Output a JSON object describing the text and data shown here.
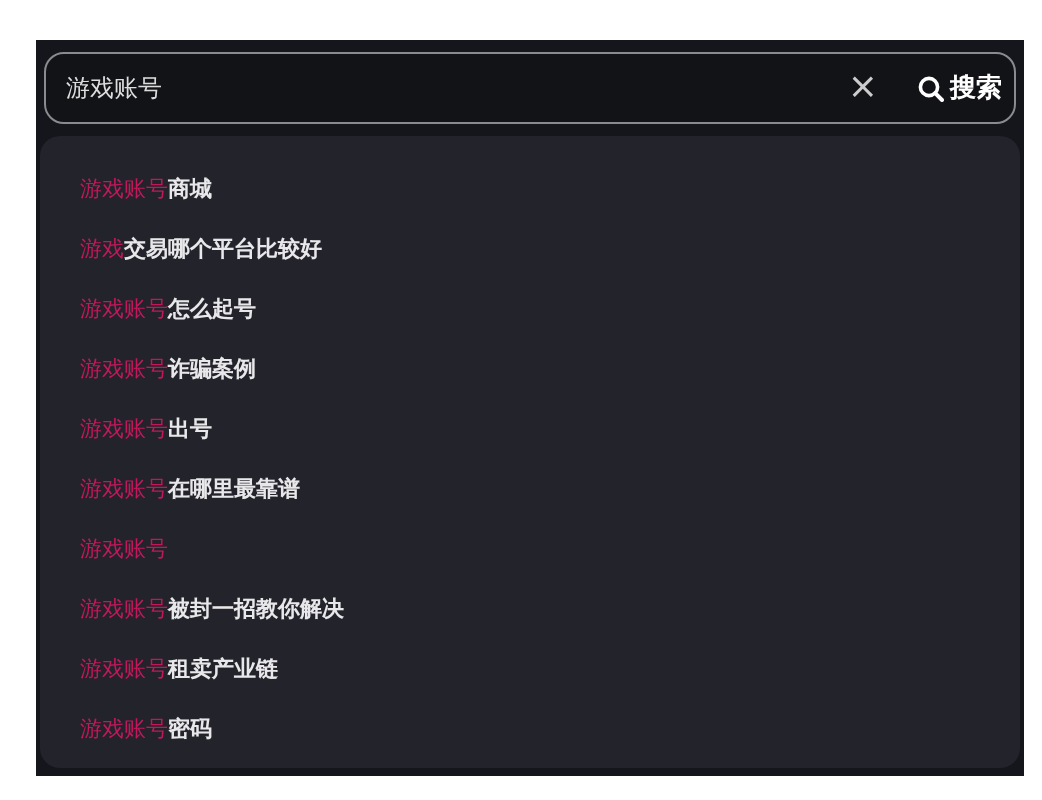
{
  "search": {
    "value": "游戏账号",
    "clear": "×",
    "button": "搜索"
  },
  "suggestions": [
    {
      "match": "游戏账号",
      "rest": "商城"
    },
    {
      "match": "游戏",
      "rest": "交易哪个平台比较好"
    },
    {
      "match": "游戏账号",
      "rest": "怎么起号"
    },
    {
      "match": "游戏账号",
      "rest": "诈骗案例"
    },
    {
      "match": "游戏账号",
      "rest": "出号"
    },
    {
      "match": "游戏账号",
      "rest": "在哪里最靠谱"
    },
    {
      "match": "游戏账号"
    },
    {
      "match": "游戏账号",
      "rest": "被封一招教你解决"
    },
    {
      "match": "游戏账号",
      "rest": "租卖产业链"
    },
    {
      "match": "游戏账号",
      "rest": "密码"
    }
  ]
}
